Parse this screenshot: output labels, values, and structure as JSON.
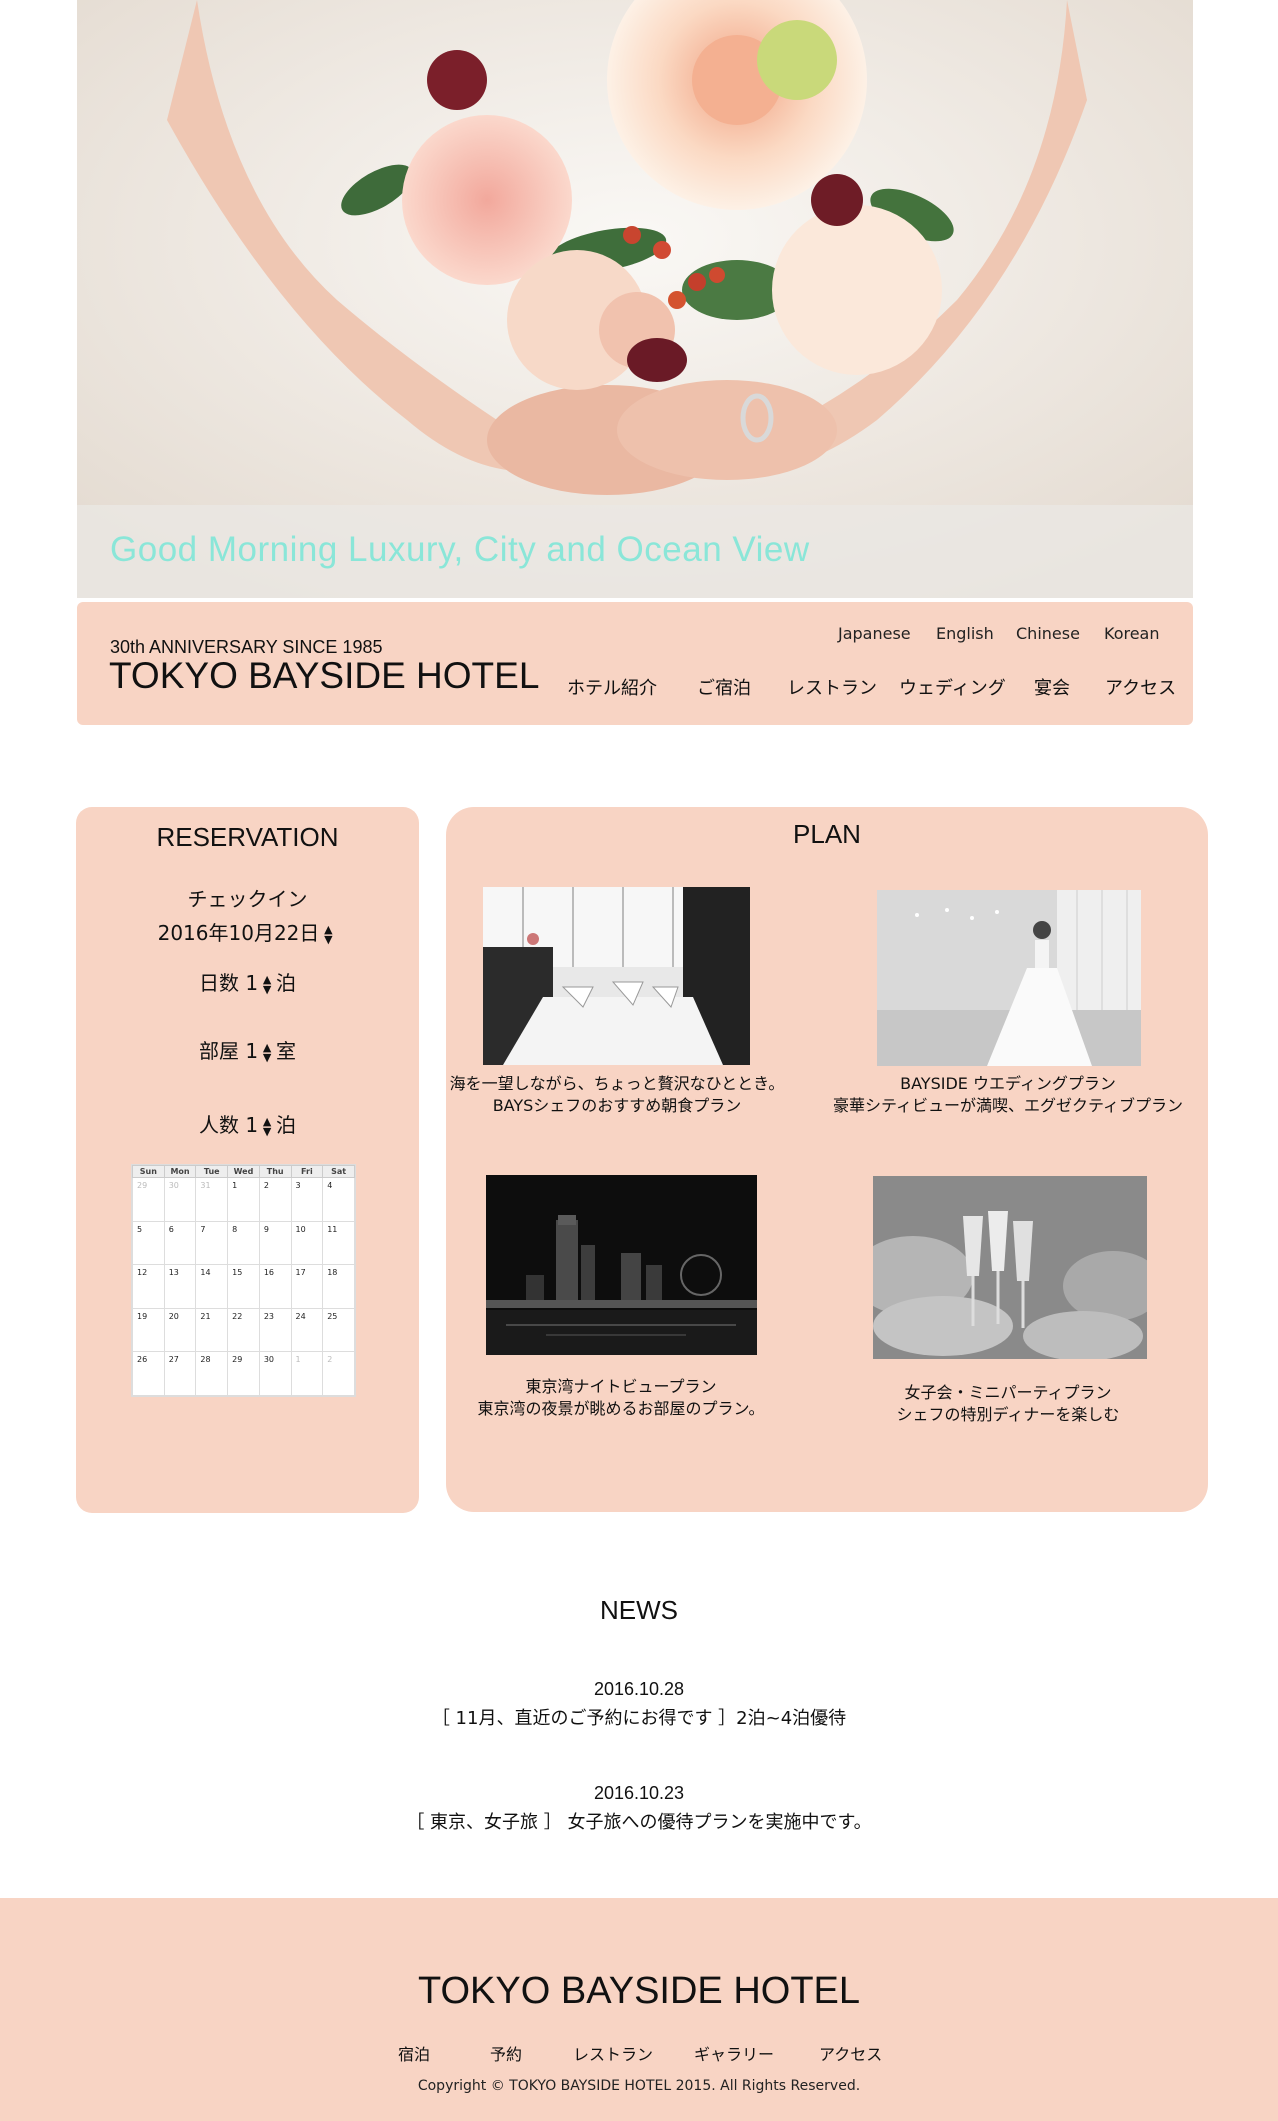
{
  "hero": {
    "tagline": "Good Morning Luxury, City and Ocean View",
    "image": "bride-bouquet-photo"
  },
  "header": {
    "anniversary": "30th ANNIVERSARY SINCE 1985",
    "brand": "TOKYO BAYSIDE HOTEL",
    "languages": [
      "Japanese",
      "English",
      "Chinese",
      "Korean"
    ],
    "nav": [
      "ホテル紹介",
      "ご宿泊",
      "レストラン",
      "ウェディング",
      "宴会",
      "アクセス"
    ]
  },
  "reservation": {
    "title": "RESERVATION",
    "checkin_label": "チェックイン",
    "checkin_date": "2016年10月22日",
    "nights": {
      "label": "日数",
      "value": "1",
      "unit": "泊"
    },
    "rooms": {
      "label": "部屋",
      "value": "1",
      "unit": "室"
    },
    "people": {
      "label": "人数",
      "value": "1",
      "unit": "泊"
    },
    "spin_glyph": "▲▼",
    "calendar": {
      "days": [
        "Sun",
        "Mon",
        "Tue",
        "Wed",
        "Thu",
        "Fri",
        "Sat"
      ],
      "weeks": [
        [
          "29",
          "30",
          "31",
          "1",
          "2",
          "3",
          "4"
        ],
        [
          "5",
          "6",
          "7",
          "8",
          "9",
          "10",
          "11"
        ],
        [
          "12",
          "13",
          "14",
          "15",
          "16",
          "17",
          "18"
        ],
        [
          "19",
          "20",
          "21",
          "22",
          "23",
          "24",
          "25"
        ],
        [
          "26",
          "27",
          "28",
          "29",
          "30",
          "1",
          "2"
        ]
      ]
    }
  },
  "plan": {
    "title": "PLAN",
    "items": [
      {
        "line1": "海を一望しながら、ちょっと贅沢なひととき。",
        "line2": "BAYSシェフのおすすめ朝食プラン",
        "image": "restaurant-table-photo"
      },
      {
        "line1": "BAYSIDE ウエディングプラン",
        "line2": "豪華シティビューが満喫、エグゼクティブプラン",
        "image": "bride-photo"
      },
      {
        "line1": "東京湾ナイトビュープラン",
        "line2": "東京湾の夜景が眺めるお部屋のプラン。",
        "image": "night-skyline-photo"
      },
      {
        "line1": "女子会・ミニパーティプラン",
        "line2": "シェフの特別ディナーを楽しむ",
        "image": "champagne-toast-photo"
      }
    ]
  },
  "news": {
    "title": "NEWS",
    "items": [
      {
        "date": "2016.10.28",
        "text": "［ 11月、直近のご予約にお得です ］2泊~4泊優待"
      },
      {
        "date": "2016.10.23",
        "text": "［ 東京、女子旅 ］ 女子旅への優待プランを実施中です。"
      }
    ]
  },
  "footer": {
    "brand": "TOKYO BAYSIDE HOTEL",
    "nav": [
      "宿泊",
      "予約",
      "レストラン",
      "ギャラリー",
      "アクセス"
    ],
    "copyright": "Copyright © TOKYO BAYSIDE HOTEL 2015. All Rights Reserved."
  },
  "colors": {
    "accent_bg": "#f8d4c4",
    "tagline": "#8ae6d8"
  }
}
